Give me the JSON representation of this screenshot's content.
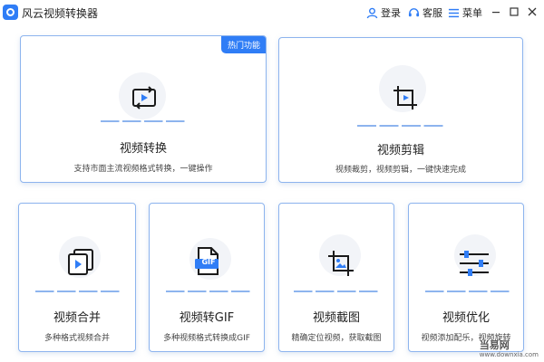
{
  "app": {
    "title": "风云视频转换器",
    "login_label": "登录",
    "service_label": "客服",
    "menu_label": "菜单"
  },
  "colors": {
    "accent": "#2f7df6",
    "card_border": "#8db4ee",
    "icon_bg": "#f2f4f8"
  },
  "cards": {
    "convert": {
      "title": "视频转换",
      "desc": "支持市面主流视频格式转换，一键操作",
      "badge": "热门功能",
      "icon": "convert-icon"
    },
    "clip": {
      "title": "视频剪辑",
      "desc": "视频裁剪，视频剪辑，一键快速完成",
      "icon": "crop-icon"
    },
    "merge": {
      "title": "视频合并",
      "desc": "多种格式视频合并",
      "icon": "merge-icon"
    },
    "gif": {
      "title": "视频转GIF",
      "desc": "多种视频格式转换成GIF",
      "icon": "gif-file-icon",
      "icon_text": "GIF"
    },
    "screenshot": {
      "title": "视频截图",
      "desc": "精确定位视频，获取截图",
      "icon": "crop-image-icon"
    },
    "optimize": {
      "title": "视频优化",
      "desc": "视频添加配乐，视频旋转",
      "icon": "sliders-icon"
    }
  },
  "watermark": {
    "name": "当易网",
    "url": "www.downxia.com"
  }
}
